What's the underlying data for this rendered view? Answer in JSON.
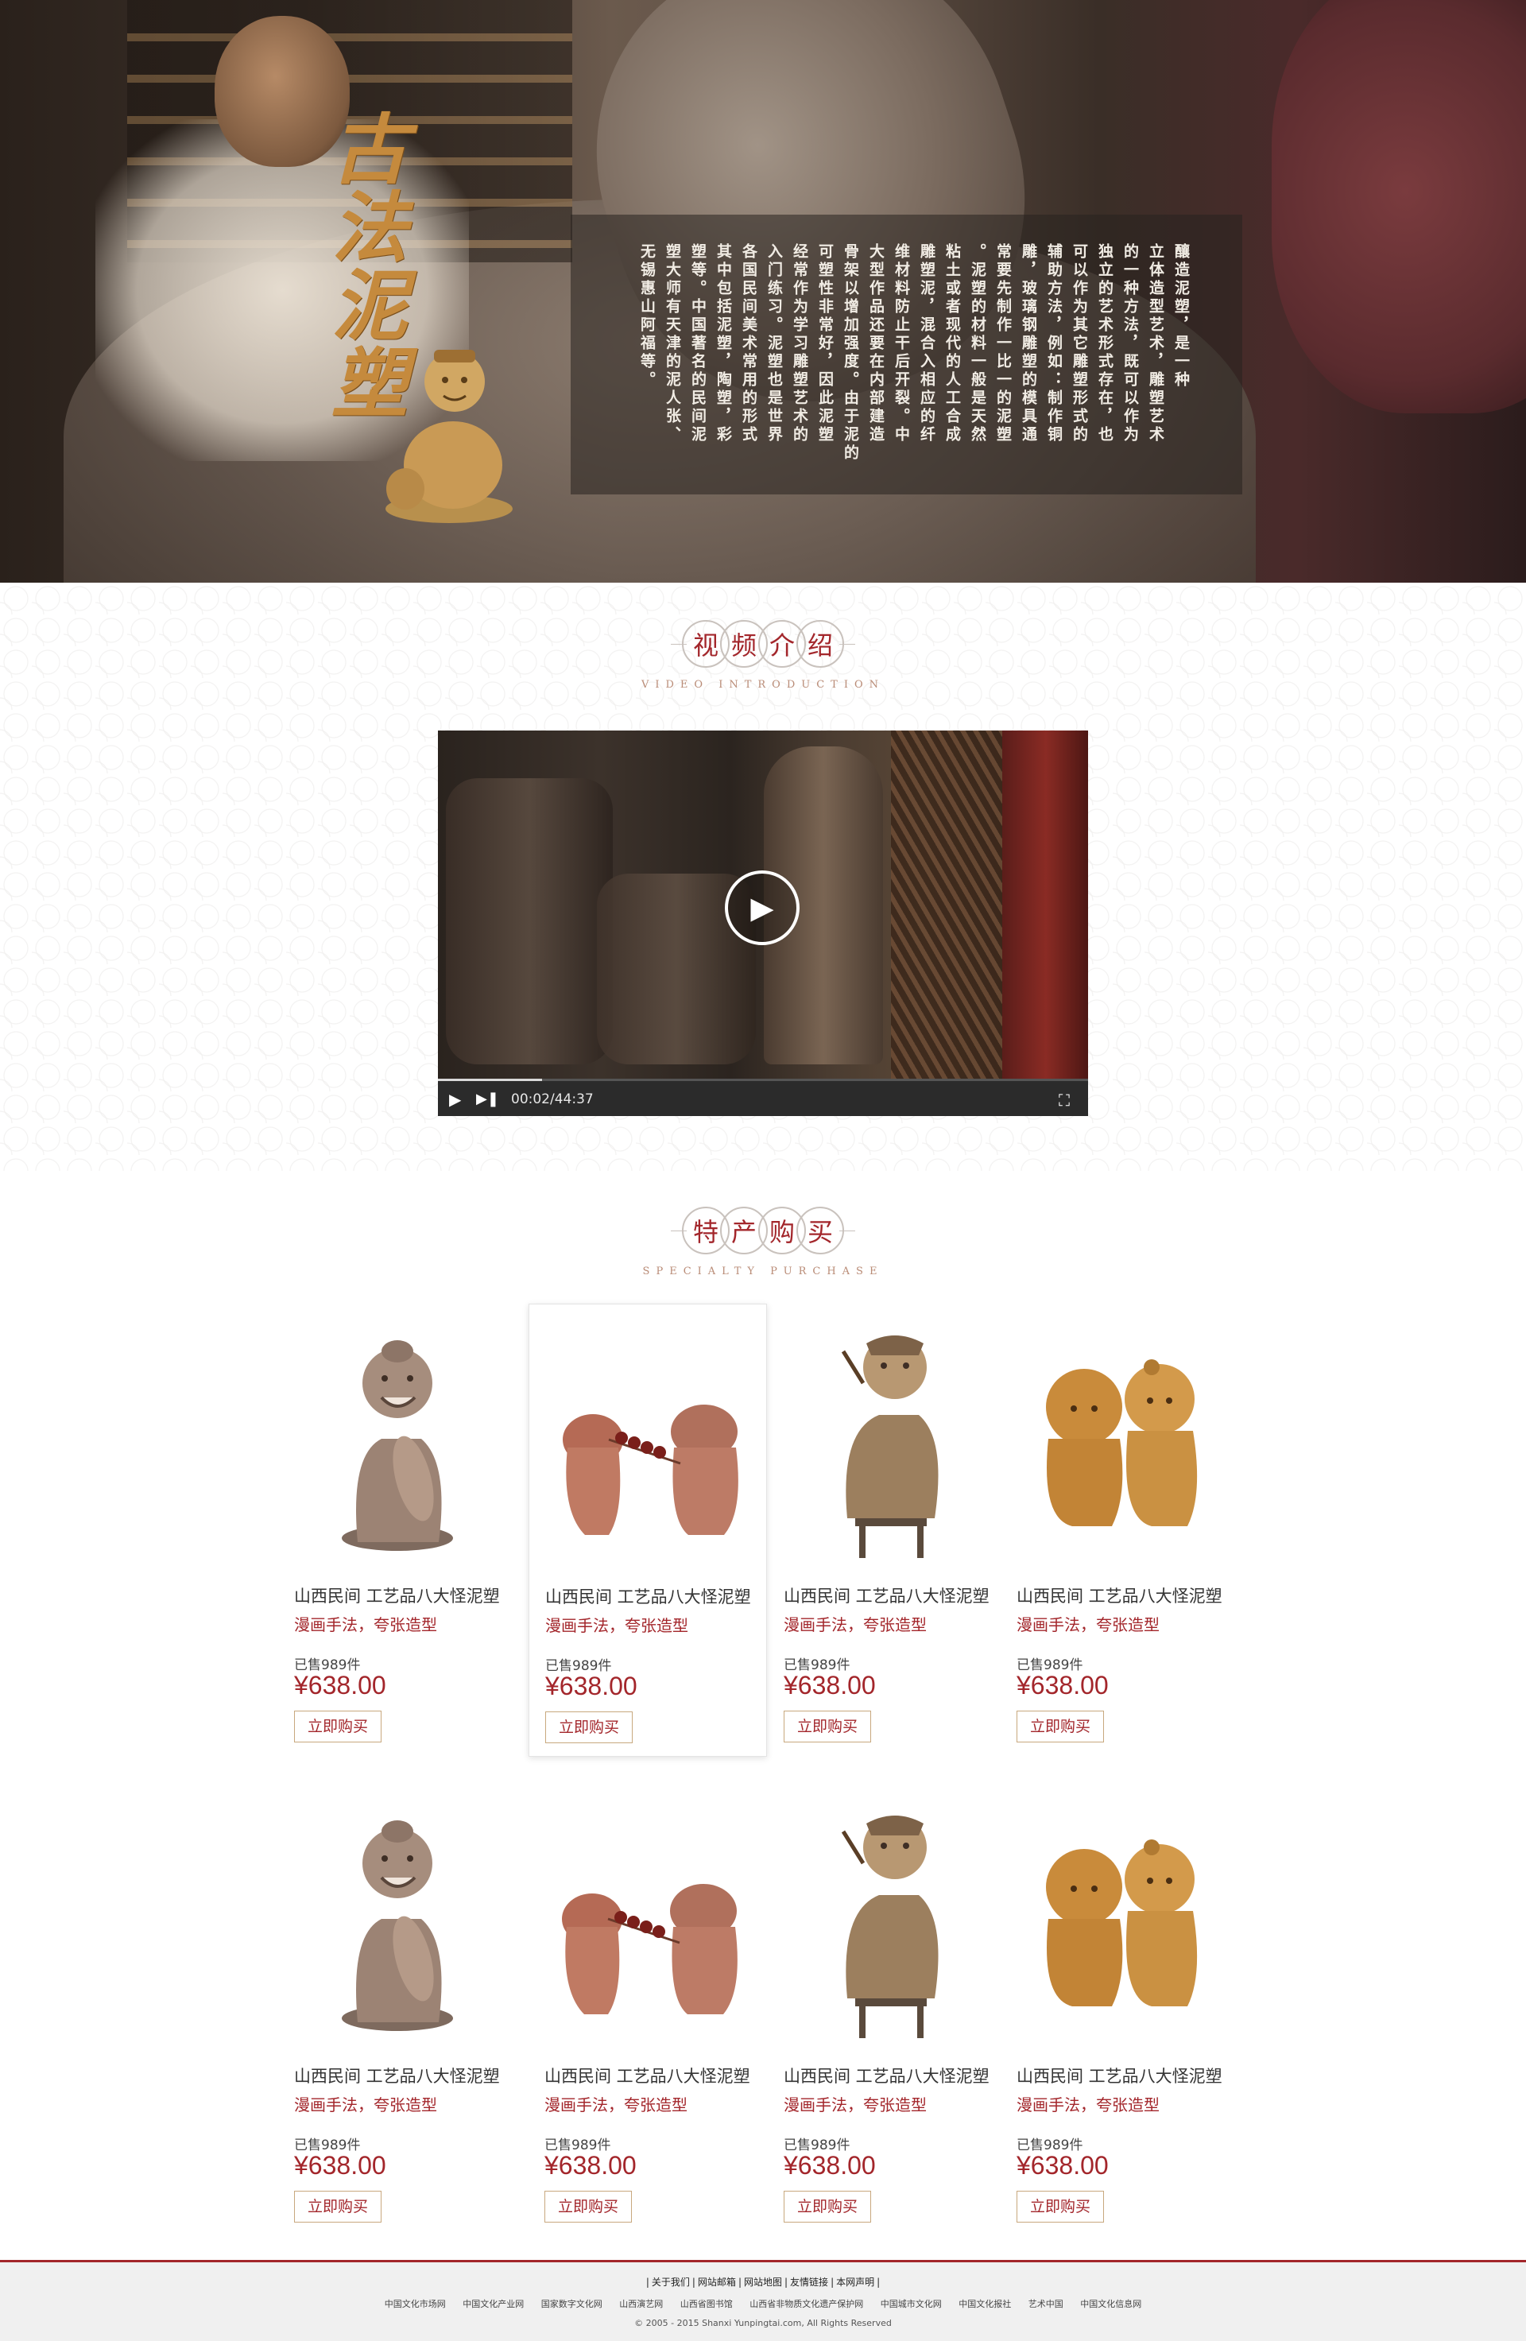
{
  "hero": {
    "title_chars": [
      "古",
      "法",
      "泥",
      "塑"
    ],
    "columns": [
      "釀造泥塑，是一种",
      "立体造型艺术，雕塑艺术",
      "的一种方法，既可以作为",
      "独立的艺术形式存在，也",
      "可以作为其它雕塑形式的",
      "辅助方法，例如：制作铜",
      "雕，玻璃钢雕塑的模具通",
      "常要先制作一比一的泥塑",
      "。泥塑的材料一般是天然",
      "粘土或者现代的人工合成",
      "雕塑泥，混合入相应的纤",
      "维材料防止干后开裂。中",
      "大型作品还要在内部建造",
      "骨架以增加强度。由于泥的",
      "可塑性非常好，因此泥塑",
      "经常作为学习雕塑艺术的",
      "入门练习。泥塑也是世界",
      "各国民间美术常用的形式",
      "其中包括泥塑，陶塑，彩",
      "塑等。中国著名的民间泥",
      "塑大师有天津的泥人张、",
      "无锡惠山阿福等。"
    ]
  },
  "video_section": {
    "title_chars": [
      "视",
      "频",
      "介",
      "绍"
    ],
    "subtitle": "VIDEO INTRODUCTION",
    "player": {
      "time": "00:02/44:37",
      "progress": 0.16
    }
  },
  "products_section": {
    "title_chars": [
      "特",
      "产",
      "购",
      "买"
    ],
    "subtitle": "SPECIALTY PURCHASE",
    "items": [
      {
        "name": "山西民间 工艺品八大怪泥塑",
        "sub": "漫画手法，夸张造型",
        "sold": "已售989件",
        "price": "¥638.00",
        "buy": "立即购买",
        "figure": "boy-with-fish"
      },
      {
        "name": "山西民间 工艺品八大怪泥塑",
        "sub": "漫画手法，夸张造型",
        "sold": "已售989件",
        "price": "¥638.00",
        "buy": "立即购买",
        "figure": "candied-haws-pair"
      },
      {
        "name": "山西民间 工艺品八大怪泥塑",
        "sub": "漫画手法，夸张造型",
        "sold": "已售989件",
        "price": "¥638.00",
        "buy": "立即购买",
        "figure": "old-man-pipe"
      },
      {
        "name": "山西民间 工艺品八大怪泥塑",
        "sub": "漫画手法，夸张造型",
        "sold": "已售989件",
        "price": "¥638.00",
        "buy": "立即购买",
        "figure": "hugging-children"
      },
      {
        "name": "山西民间 工艺品八大怪泥塑",
        "sub": "漫画手法，夸张造型",
        "sold": "已售989件",
        "price": "¥638.00",
        "buy": "立即购买",
        "figure": "boy-with-fish"
      },
      {
        "name": "山西民间 工艺品八大怪泥塑",
        "sub": "漫画手法，夸张造型",
        "sold": "已售989件",
        "price": "¥638.00",
        "buy": "立即购买",
        "figure": "candied-haws-pair"
      },
      {
        "name": "山西民间 工艺品八大怪泥塑",
        "sub": "漫画手法，夸张造型",
        "sold": "已售989件",
        "price": "¥638.00",
        "buy": "立即购买",
        "figure": "old-man-pipe"
      },
      {
        "name": "山西民间 工艺品八大怪泥塑",
        "sub": "漫画手法，夸张造型",
        "sold": "已售989件",
        "price": "¥638.00",
        "buy": "立即购买",
        "figure": "hugging-children"
      }
    ]
  },
  "footer": {
    "nav": [
      "关于我们",
      "网站邮箱",
      "网站地图",
      "友情链接",
      "本网声明"
    ],
    "links": [
      "中国文化市场网",
      "中国文化产业网",
      "国家数字文化网",
      "山西演艺网",
      "山西省图书馆",
      "山西省非物质文化遗产保护网",
      "中国城市文化网",
      "中国文化报社",
      "艺术中国",
      "中国文化信息网"
    ],
    "copyright": "© 2005 - 2015 Shanxi Yunpingtai.com, All Rights Reserved"
  },
  "colors": {
    "accent_red": "#a3262b",
    "hero_title_gold": "#c58a3d",
    "button_border": "#c8a87e"
  }
}
